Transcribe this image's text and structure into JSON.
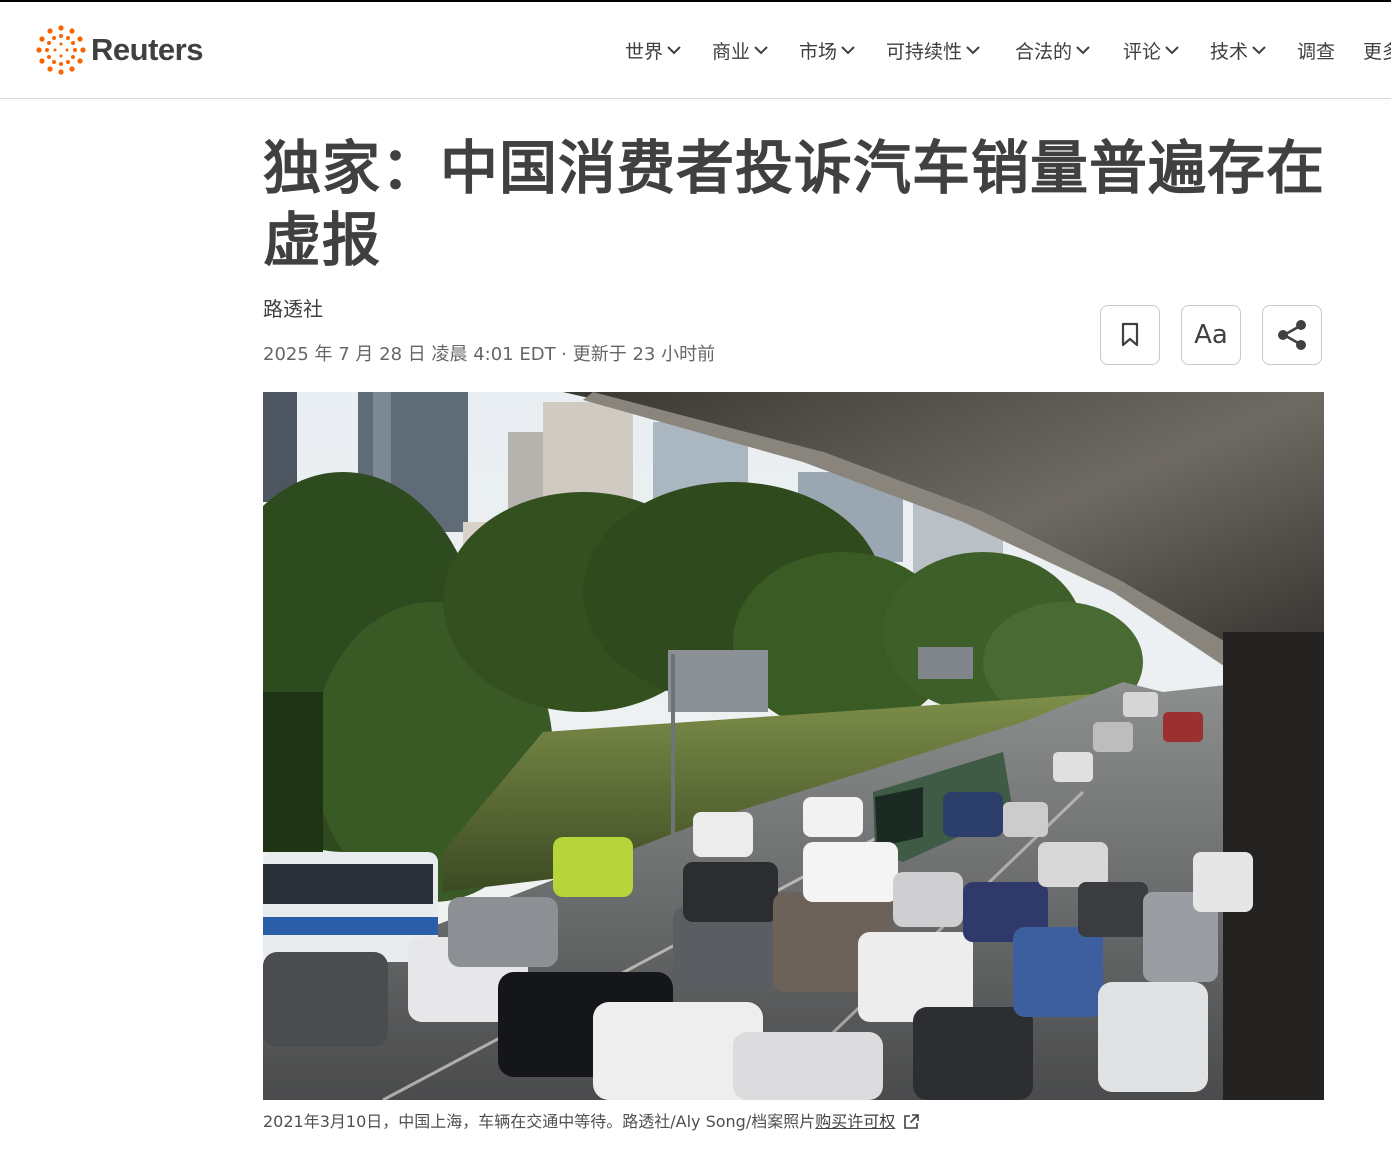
{
  "header": {
    "brand": "Reuters",
    "brand_color": "#fa6400",
    "nav": [
      {
        "label": "世界",
        "dropdown": true
      },
      {
        "label": "商业",
        "dropdown": true
      },
      {
        "label": "市场",
        "dropdown": true
      },
      {
        "label": "可持续性",
        "dropdown": true
      },
      {
        "label": "合法的",
        "dropdown": true
      },
      {
        "label": "评论",
        "dropdown": true
      },
      {
        "label": "技术",
        "dropdown": true
      },
      {
        "label": "调查",
        "dropdown": false
      },
      {
        "label": "更多",
        "dropdown": false
      }
    ]
  },
  "article": {
    "title": "独家：中国消费者投诉汽车销量普遍存在虚报",
    "byline": "路透社",
    "dateline": "2025 年 7 月 28 日 凌晨 4:01 EDT · 更新于 23 小时前"
  },
  "toolbar": {
    "bookmark_icon": "bookmark-icon",
    "text_size_label": "Aa",
    "share_icon": "share-icon"
  },
  "photo": {
    "caption": "2021年3月10日，中国上海，车辆在交通中等待。路透社/Aly Song/档案照片",
    "license_link": "购买许可权",
    "link_icon": "external-link-icon"
  }
}
